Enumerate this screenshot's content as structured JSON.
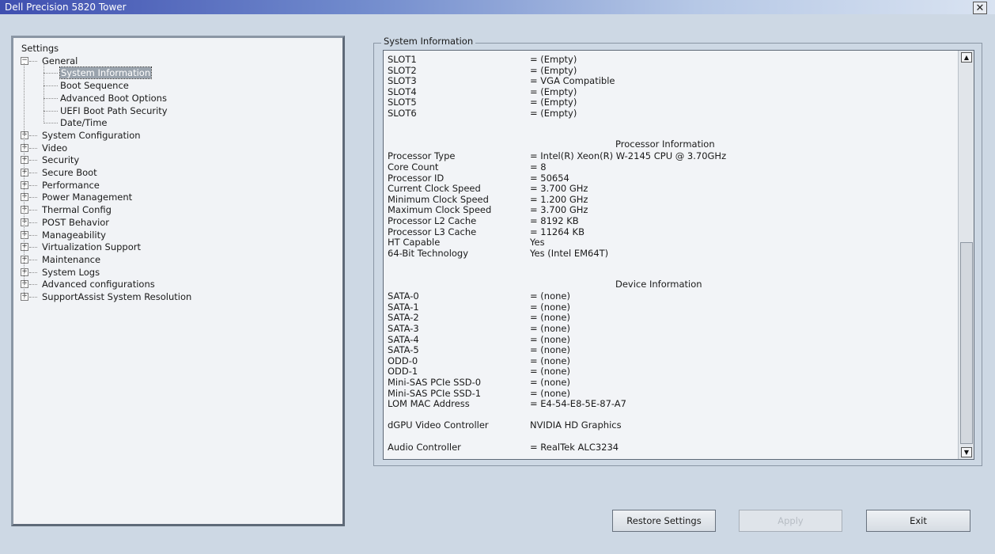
{
  "window": {
    "title": "Dell Precision 5820 Tower",
    "close_glyph": "✕"
  },
  "tree": {
    "root": "Settings",
    "items": [
      {
        "label": "General",
        "expanded": true,
        "children": [
          "System Information",
          "Boot Sequence",
          "Advanced Boot Options",
          "UEFI Boot Path Security",
          "Date/Time"
        ],
        "selected_child": 0
      },
      {
        "label": "System Configuration"
      },
      {
        "label": "Video"
      },
      {
        "label": "Security"
      },
      {
        "label": "Secure Boot"
      },
      {
        "label": "Performance"
      },
      {
        "label": "Power Management"
      },
      {
        "label": "Thermal Config"
      },
      {
        "label": "POST Behavior"
      },
      {
        "label": "Manageability"
      },
      {
        "label": "Virtualization Support"
      },
      {
        "label": "Maintenance"
      },
      {
        "label": "System Logs"
      },
      {
        "label": "Advanced configurations"
      },
      {
        "label": "SupportAssist System Resolution"
      }
    ]
  },
  "info": {
    "group_label": "System Information",
    "rows": [
      {
        "label": "SLOT1",
        "value": "= (Empty)"
      },
      {
        "label": "SLOT2",
        "value": "= (Empty)"
      },
      {
        "label": "SLOT3",
        "value": "= VGA Compatible"
      },
      {
        "label": "SLOT4",
        "value": "= (Empty)"
      },
      {
        "label": "SLOT5",
        "value": "= (Empty)"
      },
      {
        "label": "SLOT6",
        "value": "= (Empty)"
      },
      {
        "section": "Processor Information"
      },
      {
        "label": "Processor Type",
        "value": "= Intel(R) Xeon(R) W-2145 CPU @ 3.70GHz"
      },
      {
        "label": "Core Count",
        "value": "= 8"
      },
      {
        "label": "Processor ID",
        "value": "= 50654"
      },
      {
        "label": "Current Clock Speed",
        "value": "= 3.700 GHz"
      },
      {
        "label": "Minimum Clock Speed",
        "value": "= 1.200 GHz"
      },
      {
        "label": "Maximum Clock Speed",
        "value": "= 3.700 GHz"
      },
      {
        "label": "Processor L2 Cache",
        "value": "= 8192 KB"
      },
      {
        "label": "Processor L3 Cache",
        "value": "= 11264 KB"
      },
      {
        "label": "HT Capable",
        "value": "Yes"
      },
      {
        "label": "64-Bit Technology",
        "value": "Yes (Intel EM64T)"
      },
      {
        "section": "Device Information"
      },
      {
        "label": "SATA-0",
        "value": "= (none)"
      },
      {
        "label": "SATA-1",
        "value": "= (none)"
      },
      {
        "label": "SATA-2",
        "value": "= (none)"
      },
      {
        "label": "SATA-3",
        "value": "= (none)"
      },
      {
        "label": "SATA-4",
        "value": "= (none)"
      },
      {
        "label": "SATA-5",
        "value": "= (none)"
      },
      {
        "label": "ODD-0",
        "value": "= (none)"
      },
      {
        "label": "ODD-1",
        "value": "= (none)"
      },
      {
        "label": "Mini-SAS PCIe SSD-0",
        "value": "= (none)"
      },
      {
        "label": "Mini-SAS PCIe SSD-1",
        "value": "= (none)"
      },
      {
        "label": "LOM MAC Address",
        "value": "= E4-54-E8-5E-87-A7"
      },
      {
        "label": "dGPU Video Controller",
        "value": "NVIDIA HD Graphics"
      },
      {
        "label": "Audio Controller",
        "value": "= RealTek ALC3234"
      }
    ]
  },
  "scrollbar": {
    "up_glyph": "▲",
    "down_glyph": "▼"
  },
  "buttons": {
    "restore": "Restore Settings",
    "apply": "Apply",
    "exit": "Exit"
  }
}
